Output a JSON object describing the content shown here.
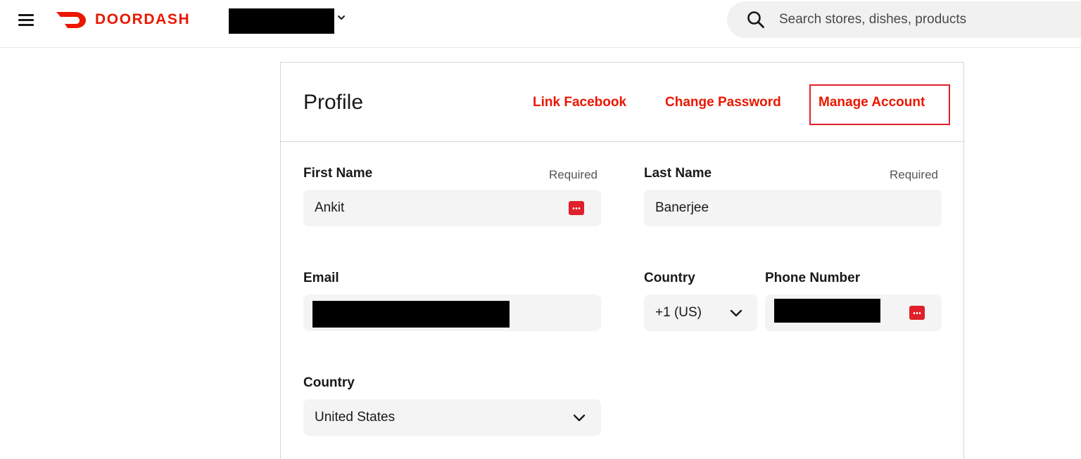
{
  "header": {
    "logo_text": "DOORDASH",
    "brand_color": "#eb1700",
    "menu_icon": "hamburger-menu-icon",
    "search": {
      "placeholder": "Search stores, dishes, products",
      "icon": "search-icon"
    }
  },
  "profile": {
    "title": "Profile",
    "links": {
      "facebook": "Link Facebook",
      "password": "Change Password",
      "manage": "Manage Account"
    },
    "highlight_color": "#e0202b"
  },
  "form": {
    "first_name": {
      "label": "First Name",
      "required": "Required",
      "value": "Ankit"
    },
    "last_name": {
      "label": "Last Name",
      "required": "Required",
      "value": "Banerjee"
    },
    "email": {
      "label": "Email"
    },
    "phone_country": {
      "label": "Country",
      "value": "+1 (US)"
    },
    "phone_number": {
      "label": "Phone Number"
    },
    "country": {
      "label": "Country",
      "value": "United States"
    }
  }
}
